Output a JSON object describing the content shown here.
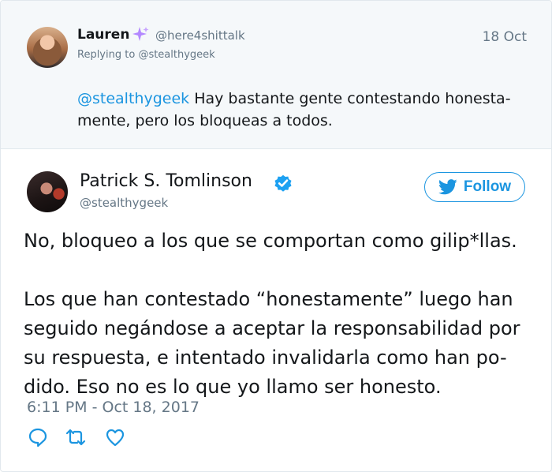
{
  "reply": {
    "display_name": "Lauren",
    "handle": "@here4shittalk",
    "date": "18 Oct",
    "replying_prefix": "Replying to",
    "replying_handle": "@stealthygeek",
    "mention": "@stealthygeek",
    "text_line1": "Hay bastante gente contestando honesta-",
    "text_line2": "mente, pero los bloqueas a todos.",
    "icons": {
      "badge": "sparkle-icon"
    }
  },
  "tweet": {
    "display_name": "Patrick S. Tomlinson",
    "handle": "@stealthygeek",
    "follow_label": "Follow",
    "paragraph1": "No, bloqueo a los que se comportan como gilip*llas.",
    "paragraph2_lines": [
      "Los que han contestado “honestamente” luego han",
      "seguido negándose a aceptar la responsabilidad por",
      "su respuesta, e intentado invalidarla como han po-",
      "dido. Eso no es lo que yo llamo ser honesto."
    ],
    "timestamp": "6:11 PM - Oct 18, 2017",
    "icons": {
      "verified": "verified-icon",
      "follow": "twitter-bird-icon",
      "reply": "reply-icon",
      "retweet": "retweet-icon",
      "like": "heart-icon"
    }
  },
  "colors": {
    "accent": "#1b95e0",
    "muted": "#657786",
    "reply_background": "#f5f8fa"
  }
}
